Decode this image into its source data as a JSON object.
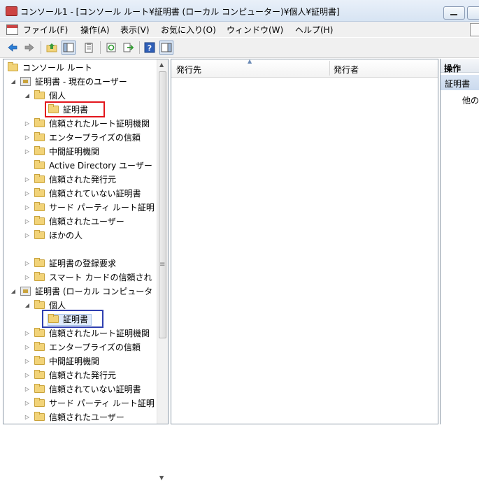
{
  "window": {
    "title": "コンソール1 - [コンソール ルート¥証明書 (ローカル コンピューター)¥個人¥証明書]"
  },
  "menu": [
    {
      "label": "ファイル(F)"
    },
    {
      "label": "操作(A)"
    },
    {
      "label": "表示(V)"
    },
    {
      "label": "お気に入り(O)"
    },
    {
      "label": "ウィンドウ(W)"
    },
    {
      "label": "ヘルプ(H)"
    }
  ],
  "toolbar": {
    "icons": [
      "back-icon",
      "forward-icon",
      "up-folder-icon",
      "show-tree-icon",
      "properties-icon",
      "refresh-icon",
      "export-icon",
      "help-icon",
      "show-action-pane-icon"
    ]
  },
  "tree": {
    "root": "コンソール ルート",
    "current_user": "証明書 - 現在のユーザー",
    "cu_items": [
      "個人",
      "証明書",
      "信頼されたルート証明機関",
      "エンタープライズの信頼",
      "中間証明機関",
      "Active Directory ユーザー",
      "信頼された発行元",
      "信頼されていない証明書",
      "サード パーティ ルート証明",
      "信頼されたユーザー",
      "ほかの人",
      "証明書の登録要求",
      "スマート カードの信頼され"
    ],
    "local_computer": "証明書 (ローカル コンピュータ",
    "lc_items": [
      "個人",
      "証明書",
      "信頼されたルート証明機関",
      "エンタープライズの信頼",
      "中間証明機関",
      "信頼された発行元",
      "信頼されていない証明書",
      "サード パーティ ルート証明",
      "信頼されたユーザー"
    ]
  },
  "list": {
    "columns": [
      "発行先",
      "発行者"
    ]
  },
  "actions": {
    "header": "操作",
    "section": "証明書",
    "item": "他の操作"
  },
  "highlight_colors": {
    "red": "#e3161c",
    "blue": "#2f3fb0"
  }
}
